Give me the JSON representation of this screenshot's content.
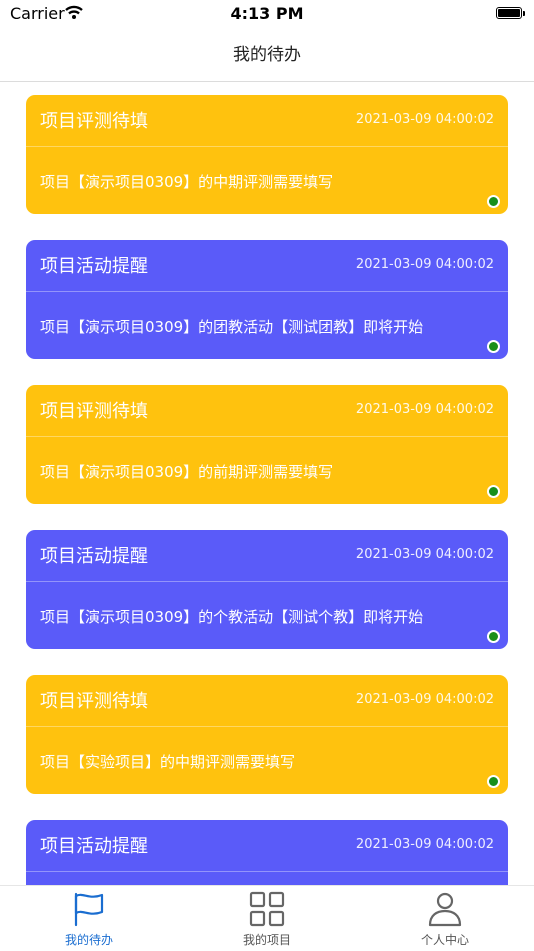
{
  "status_bar": {
    "carrier": "Carrier",
    "time": "4:13 PM"
  },
  "nav": {
    "title": "我的待办"
  },
  "cards": [
    {
      "title": "项目评测待填",
      "time": "2021-03-09 04:00:02",
      "message": "项目【演示项目0309】的中期评测需要填写",
      "color": "#FFC20E",
      "theme": "yellow"
    },
    {
      "title": "项目活动提醒",
      "time": "2021-03-09 04:00:02",
      "message": "项目【演示项目0309】的团教活动【测试团教】即将开始",
      "color": "#5A5BF9",
      "theme": "blue"
    },
    {
      "title": "项目评测待填",
      "time": "2021-03-09 04:00:02",
      "message": "项目【演示项目0309】的前期评测需要填写",
      "color": "#FFC20E",
      "theme": "yellow"
    },
    {
      "title": "项目活动提醒",
      "time": "2021-03-09 04:00:02",
      "message": "项目【演示项目0309】的个教活动【测试个教】即将开始",
      "color": "#5A5BF9",
      "theme": "blue"
    },
    {
      "title": "项目评测待填",
      "time": "2021-03-09 04:00:02",
      "message": "项目【实验项目】的中期评测需要填写",
      "color": "#FFC20E",
      "theme": "yellow"
    },
    {
      "title": "项目活动提醒",
      "time": "2021-03-09 04:00:02",
      "message": "",
      "color": "#5A5BF9",
      "theme": "blue"
    }
  ],
  "tabs": [
    {
      "label": "我的待办",
      "icon": "flag-icon",
      "active": true
    },
    {
      "label": "我的项目",
      "icon": "grid-icon",
      "active": false
    },
    {
      "label": "个人中心",
      "icon": "person-icon",
      "active": false
    }
  ],
  "colors": {
    "accent": "#1a6dd0",
    "dot": "#1a8f1a"
  }
}
